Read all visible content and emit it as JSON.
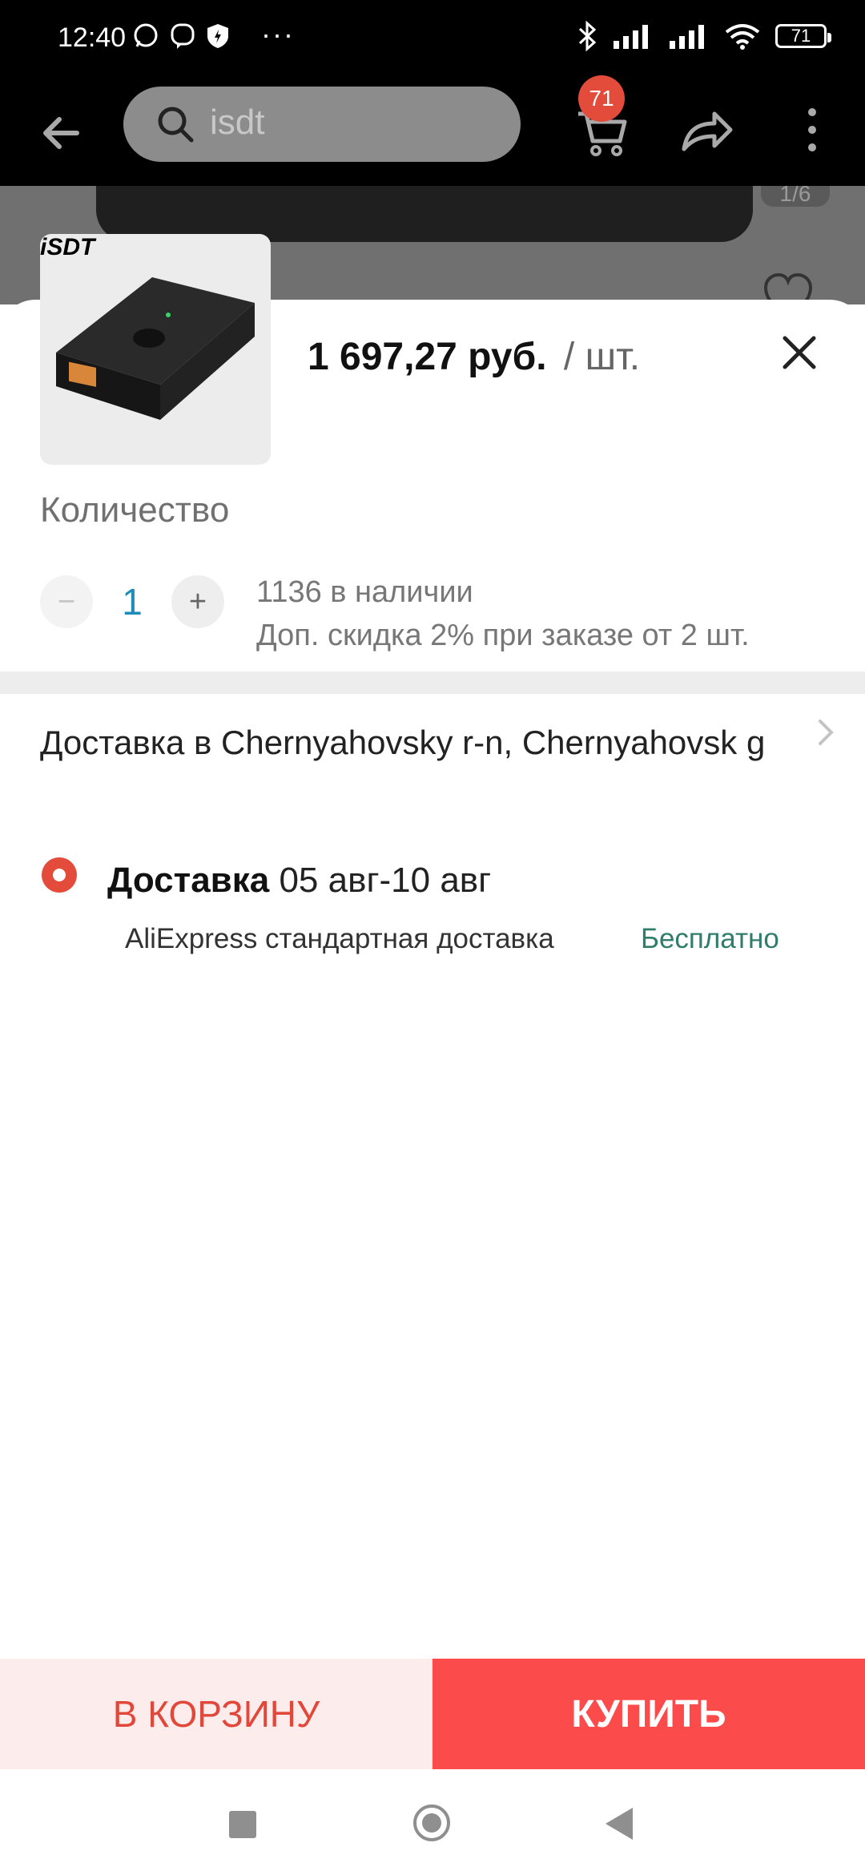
{
  "status_bar": {
    "time": "12:40",
    "dots": "···",
    "battery": "71"
  },
  "top_bar": {
    "search_value": "isdt",
    "cart_badge": "71"
  },
  "product_image": {
    "counter": "1/6"
  },
  "sheet": {
    "brand": "iSDT",
    "price": "1 697,27 руб.",
    "unit": "/ шт.",
    "quantity_title": "Количество",
    "quantity": "1",
    "minus": "−",
    "plus": "+",
    "stock": "1136 в наличии",
    "discount": "Доп. скидка 2% при заказе от 2 шт.",
    "delivery_address": "Доставка в Chernyahovsky r-n, Chernyahovsk g",
    "delivery_label": "Доставка",
    "delivery_dates": "05 авг-10 авг",
    "carrier": "AliExpress стандартная доставка",
    "shipping_price": "Бесплатно"
  },
  "buttons": {
    "add_to_cart": "В КОРЗИНУ",
    "buy": "КУПИТЬ"
  },
  "colors": {
    "accent": "#fb4b4b",
    "accent_text": "#e2483a",
    "quantity": "#1e8cb8",
    "free_shipping": "#2f7d6a"
  },
  "icons": [
    "back-arrow-icon",
    "search-icon",
    "cart-icon",
    "share-icon",
    "more-vert-icon",
    "heart-icon",
    "close-icon",
    "chevron-right-icon",
    "whatsapp-icon",
    "viber-icon",
    "shield-icon",
    "bluetooth-icon",
    "signal-icon",
    "wifi-icon"
  ]
}
